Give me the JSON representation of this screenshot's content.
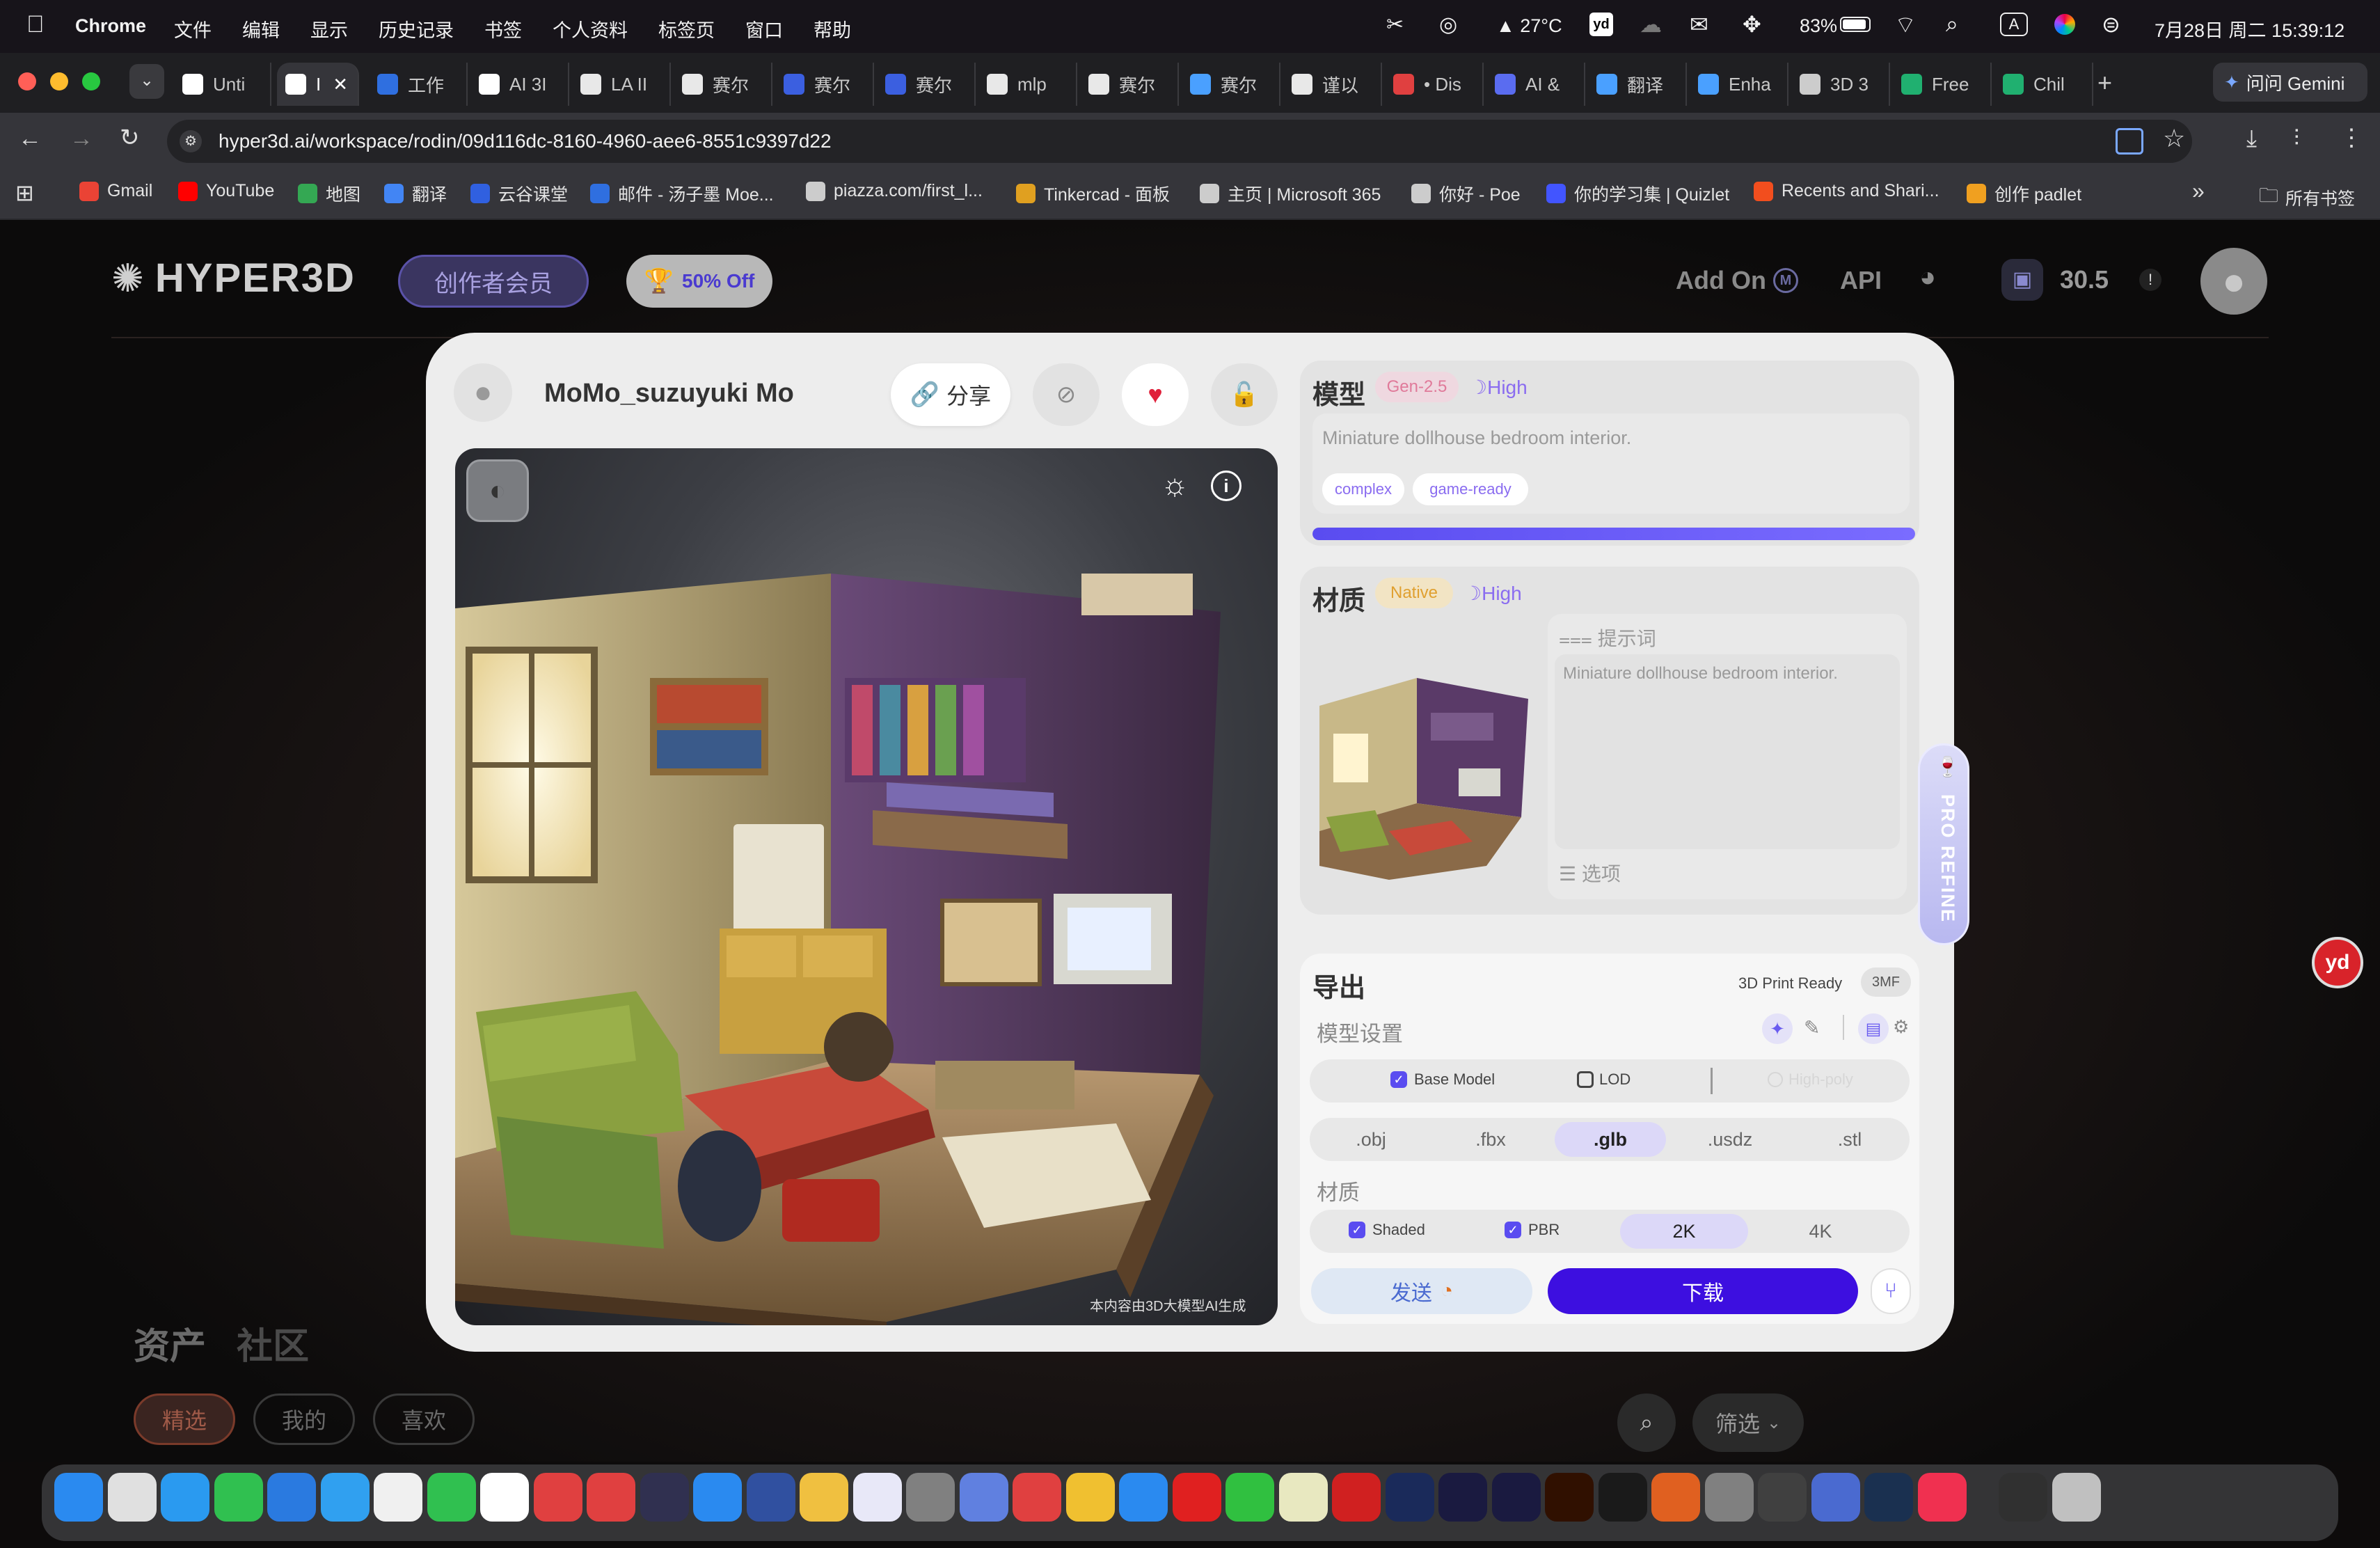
{
  "menubar": {
    "apple": "",
    "app": "Chrome",
    "items": [
      "文件",
      "编辑",
      "显示",
      "历史记录",
      "书签",
      "个人资料",
      "标签页",
      "窗口",
      "帮助"
    ],
    "weather": "27°C",
    "battery": "83%",
    "input": "A",
    "datetime": "7月28日 周二  15:39:12"
  },
  "tabs": [
    {
      "label": "Unti",
      "color": "#ffffff"
    },
    {
      "label": "I",
      "color": "#ffffff"
    },
    {
      "label": "工作",
      "color": "#2f6fe0"
    },
    {
      "label": "AI 3I",
      "color": "#ffffff"
    },
    {
      "label": "LA II",
      "color": "#e8e8e8"
    },
    {
      "label": "赛尔",
      "color": "#e8e8e8"
    },
    {
      "label": "赛尔",
      "color": "#3b5fe0"
    },
    {
      "label": "赛尔",
      "color": "#3b5fe0"
    },
    {
      "label": "mlp",
      "color": "#e8e8e8"
    },
    {
      "label": "赛尔",
      "color": "#e8e8e8"
    },
    {
      "label": "赛尔",
      "color": "#4aa0ff"
    },
    {
      "label": "谨以",
      "color": "#e8e8e8"
    },
    {
      "label": "• Dis",
      "color": "#e04040"
    },
    {
      "label": "AI &",
      "color": "#5a6cf0"
    },
    {
      "label": "翻译",
      "color": "#4aa0ff"
    },
    {
      "label": "Enha",
      "color": "#4aa0ff"
    },
    {
      "label": "3D 3",
      "color": "#cccccc"
    },
    {
      "label": "Free",
      "color": "#20b070"
    },
    {
      "label": "Chil",
      "color": "#20b070"
    }
  ],
  "gemini": "问问 Gemini",
  "url": "hyper3d.ai/workspace/rodin/09d116dc-8160-4960-aee6-8551c9397d22",
  "bookmarks": [
    {
      "label": "Gmail",
      "color": "#ea4335"
    },
    {
      "label": "YouTube",
      "color": "#ff0000"
    },
    {
      "label": "地图",
      "color": "#34a853"
    },
    {
      "label": "翻译",
      "color": "#4285f4"
    },
    {
      "label": "云谷课堂",
      "color": "#3060e0"
    },
    {
      "label": "邮件 - 汤子墨 Moe...",
      "color": "#2f6fe0"
    },
    {
      "label": "piazza.com/first_l...",
      "color": "#cccccc"
    },
    {
      "label": "Tinkercad - 面板",
      "color": "#e0a020"
    },
    {
      "label": "主页 | Microsoft 365",
      "color": "#cccccc"
    },
    {
      "label": "你好 - Poe",
      "color": "#cccccc"
    },
    {
      "label": "你的学习集 | Quizlet",
      "color": "#4255ff"
    },
    {
      "label": "Recents and Shari...",
      "color": "#f24e1e"
    },
    {
      "label": "创作 padlet",
      "color": "#f0a020"
    }
  ],
  "all_bookmarks": "所有书签",
  "site": {
    "logo": "HYPER3D",
    "member": "创作者会员",
    "discount": "50% Off",
    "addon": "Add On",
    "addon_badge": "M",
    "api": "API",
    "credits": "30.5",
    "alert": "!"
  },
  "bottom": {
    "tabs": [
      "资产",
      "社区"
    ],
    "filters": [
      "精选",
      "我的",
      "喜欢"
    ],
    "filter_btn": "筛选"
  },
  "modal": {
    "user": "MoMo_suzuyuki Mo",
    "share": "分享",
    "watermark": "本内容由3D大模型AI生成",
    "model": {
      "title": "模型",
      "gen": "Gen-2.5",
      "quality": "High",
      "prompt": "Miniature dollhouse bedroom interior.",
      "tags": [
        "complex",
        "game-ready"
      ],
      "progress": 1.0
    },
    "material": {
      "title": "材质",
      "mode": "Native",
      "quality": "High",
      "prompt_label": "提示词",
      "prompt": "Miniature dollhouse bedroom interior.",
      "options_label": "选项"
    },
    "pro_refine": "PRO REFINE",
    "export": {
      "title": "导出",
      "print": "3D Print Ready",
      "format_badge": "3MF",
      "model_settings": "模型设置",
      "base_model": "Base Model",
      "lod": "LOD",
      "highpoly": "High-poly",
      "formats": [
        ".obj",
        ".fbx",
        ".glb",
        ".usdz",
        ".stl"
      ],
      "selected_format": ".glb",
      "material_label": "材质",
      "shaded": "Shaded",
      "pbr": "PBR",
      "res": [
        "2K",
        "4K"
      ],
      "selected_res": "2K",
      "send": "发送",
      "download": "下载"
    }
  },
  "colors": {
    "accent": "#3d0fe0",
    "progress": "#6a5cff",
    "gen_pink": "#f2a0b8",
    "native_orange": "#e8a23a",
    "high_purple": "#8a6cf0"
  }
}
